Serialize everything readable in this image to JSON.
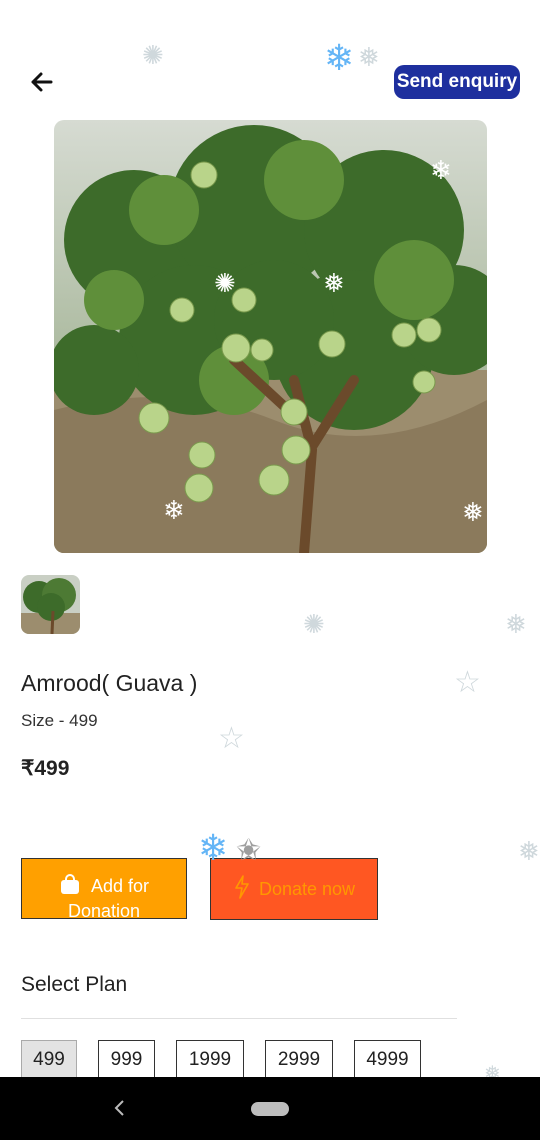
{
  "header": {
    "back_icon": "arrow-left-icon",
    "enquiry_label": "Send enquiry"
  },
  "product": {
    "title": "Amrood( Guava )",
    "size": "Size - 499",
    "price": "₹499"
  },
  "actions": {
    "add_label": "Add for Donation",
    "add_icon": "shopping-bag-icon",
    "donate_label": "Donate now",
    "donate_icon": "lightning-bolt-icon"
  },
  "plans": {
    "label": "Select Plan",
    "options": [
      "499",
      "999",
      "1999",
      "2999",
      "4999"
    ],
    "selected": "499"
  },
  "colors": {
    "enquiry_bg": "#1e2f9e",
    "add_bg": "#ffa000",
    "donate_bg": "#ff5722",
    "donate_text": "#ff9800"
  }
}
